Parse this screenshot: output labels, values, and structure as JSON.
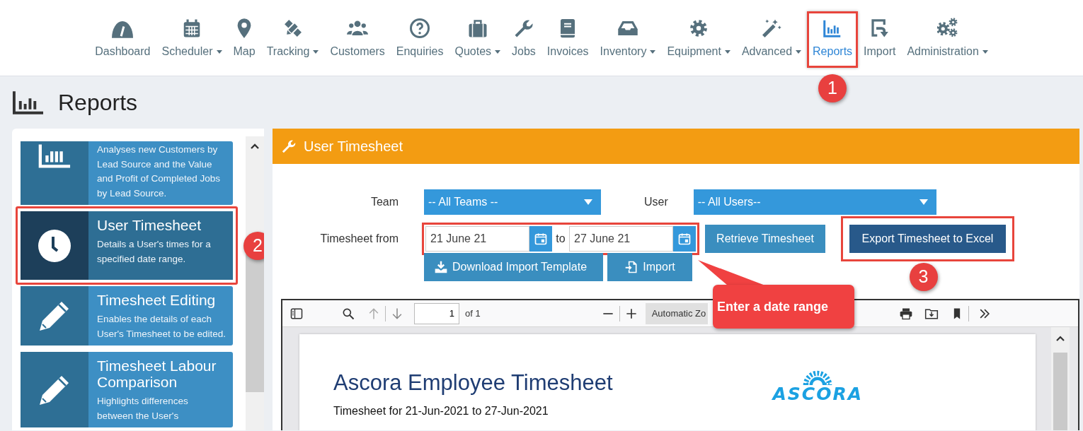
{
  "nav": {
    "items": [
      {
        "label": "Dashboard",
        "dropdown": false,
        "selected": false,
        "highlighted": false
      },
      {
        "label": "Scheduler",
        "dropdown": true,
        "selected": false,
        "highlighted": false
      },
      {
        "label": "Map",
        "dropdown": false,
        "selected": false,
        "highlighted": false
      },
      {
        "label": "Tracking",
        "dropdown": true,
        "selected": false,
        "highlighted": false
      },
      {
        "label": "Customers",
        "dropdown": false,
        "selected": false,
        "highlighted": false
      },
      {
        "label": "Enquiries",
        "dropdown": false,
        "selected": false,
        "highlighted": false
      },
      {
        "label": "Quotes",
        "dropdown": true,
        "selected": false,
        "highlighted": false
      },
      {
        "label": "Jobs",
        "dropdown": false,
        "selected": false,
        "highlighted": false
      },
      {
        "label": "Invoices",
        "dropdown": false,
        "selected": false,
        "highlighted": false
      },
      {
        "label": "Inventory",
        "dropdown": true,
        "selected": false,
        "highlighted": false
      },
      {
        "label": "Equipment",
        "dropdown": true,
        "selected": false,
        "highlighted": false
      },
      {
        "label": "Advanced",
        "dropdown": true,
        "selected": false,
        "highlighted": false
      },
      {
        "label": "Reports",
        "dropdown": false,
        "selected": true,
        "highlighted": true,
        "annotation": "1"
      },
      {
        "label": "Import",
        "dropdown": false,
        "selected": false,
        "highlighted": false
      },
      {
        "label": "Administration",
        "dropdown": true,
        "selected": false,
        "highlighted": false
      }
    ]
  },
  "page_title": "Reports",
  "sidebar": {
    "items": [
      {
        "description": "Analyses new Customers by Lead Source and the Value and Profit of Completed Jobs by Lead Source.",
        "selected": false,
        "highlighted": false
      },
      {
        "title": "User Timesheet",
        "description": "Details a User's times for a specified date range.",
        "selected": true,
        "highlighted": true,
        "annotation": "2"
      },
      {
        "title": "Timesheet Editing",
        "description": "Enables the details of each User's Timesheet to be edited.",
        "selected": false,
        "highlighted": false
      },
      {
        "title": "Timesheet Labour Comparison",
        "description": "Highlights differences between the User's",
        "selected": false,
        "highlighted": false
      }
    ]
  },
  "panel": {
    "title": "User Timesheet",
    "form": {
      "team_label": "Team",
      "team_value": "-- All Teams --",
      "user_label": "User",
      "user_value": "-- All Users--",
      "from_label": "Timesheet from",
      "from_value": "21 June 21",
      "to_label": "to",
      "to_value": "27 June 21",
      "dates_highlighted": true,
      "callout": "Enter a date range",
      "actions": [
        {
          "label": "Retrieve Timesheet",
          "kind": "retrieve",
          "highlighted": false
        },
        {
          "label": "Export Timesheet to Excel",
          "kind": "export",
          "highlighted": true,
          "annotation": "3"
        }
      ],
      "import_actions": [
        {
          "label": "Download Import Template",
          "kind": "download"
        },
        {
          "label": "Import",
          "kind": "import"
        }
      ]
    },
    "viewer": {
      "page_number": "1",
      "page_count": "of 1",
      "zoom": "Automatic Zo",
      "document": {
        "title": "Ascora Employee Timesheet",
        "subtitle": "Timesheet for 21-Jun-2021 to 27-Jun-2021",
        "logo": "ASCORA"
      }
    }
  }
}
